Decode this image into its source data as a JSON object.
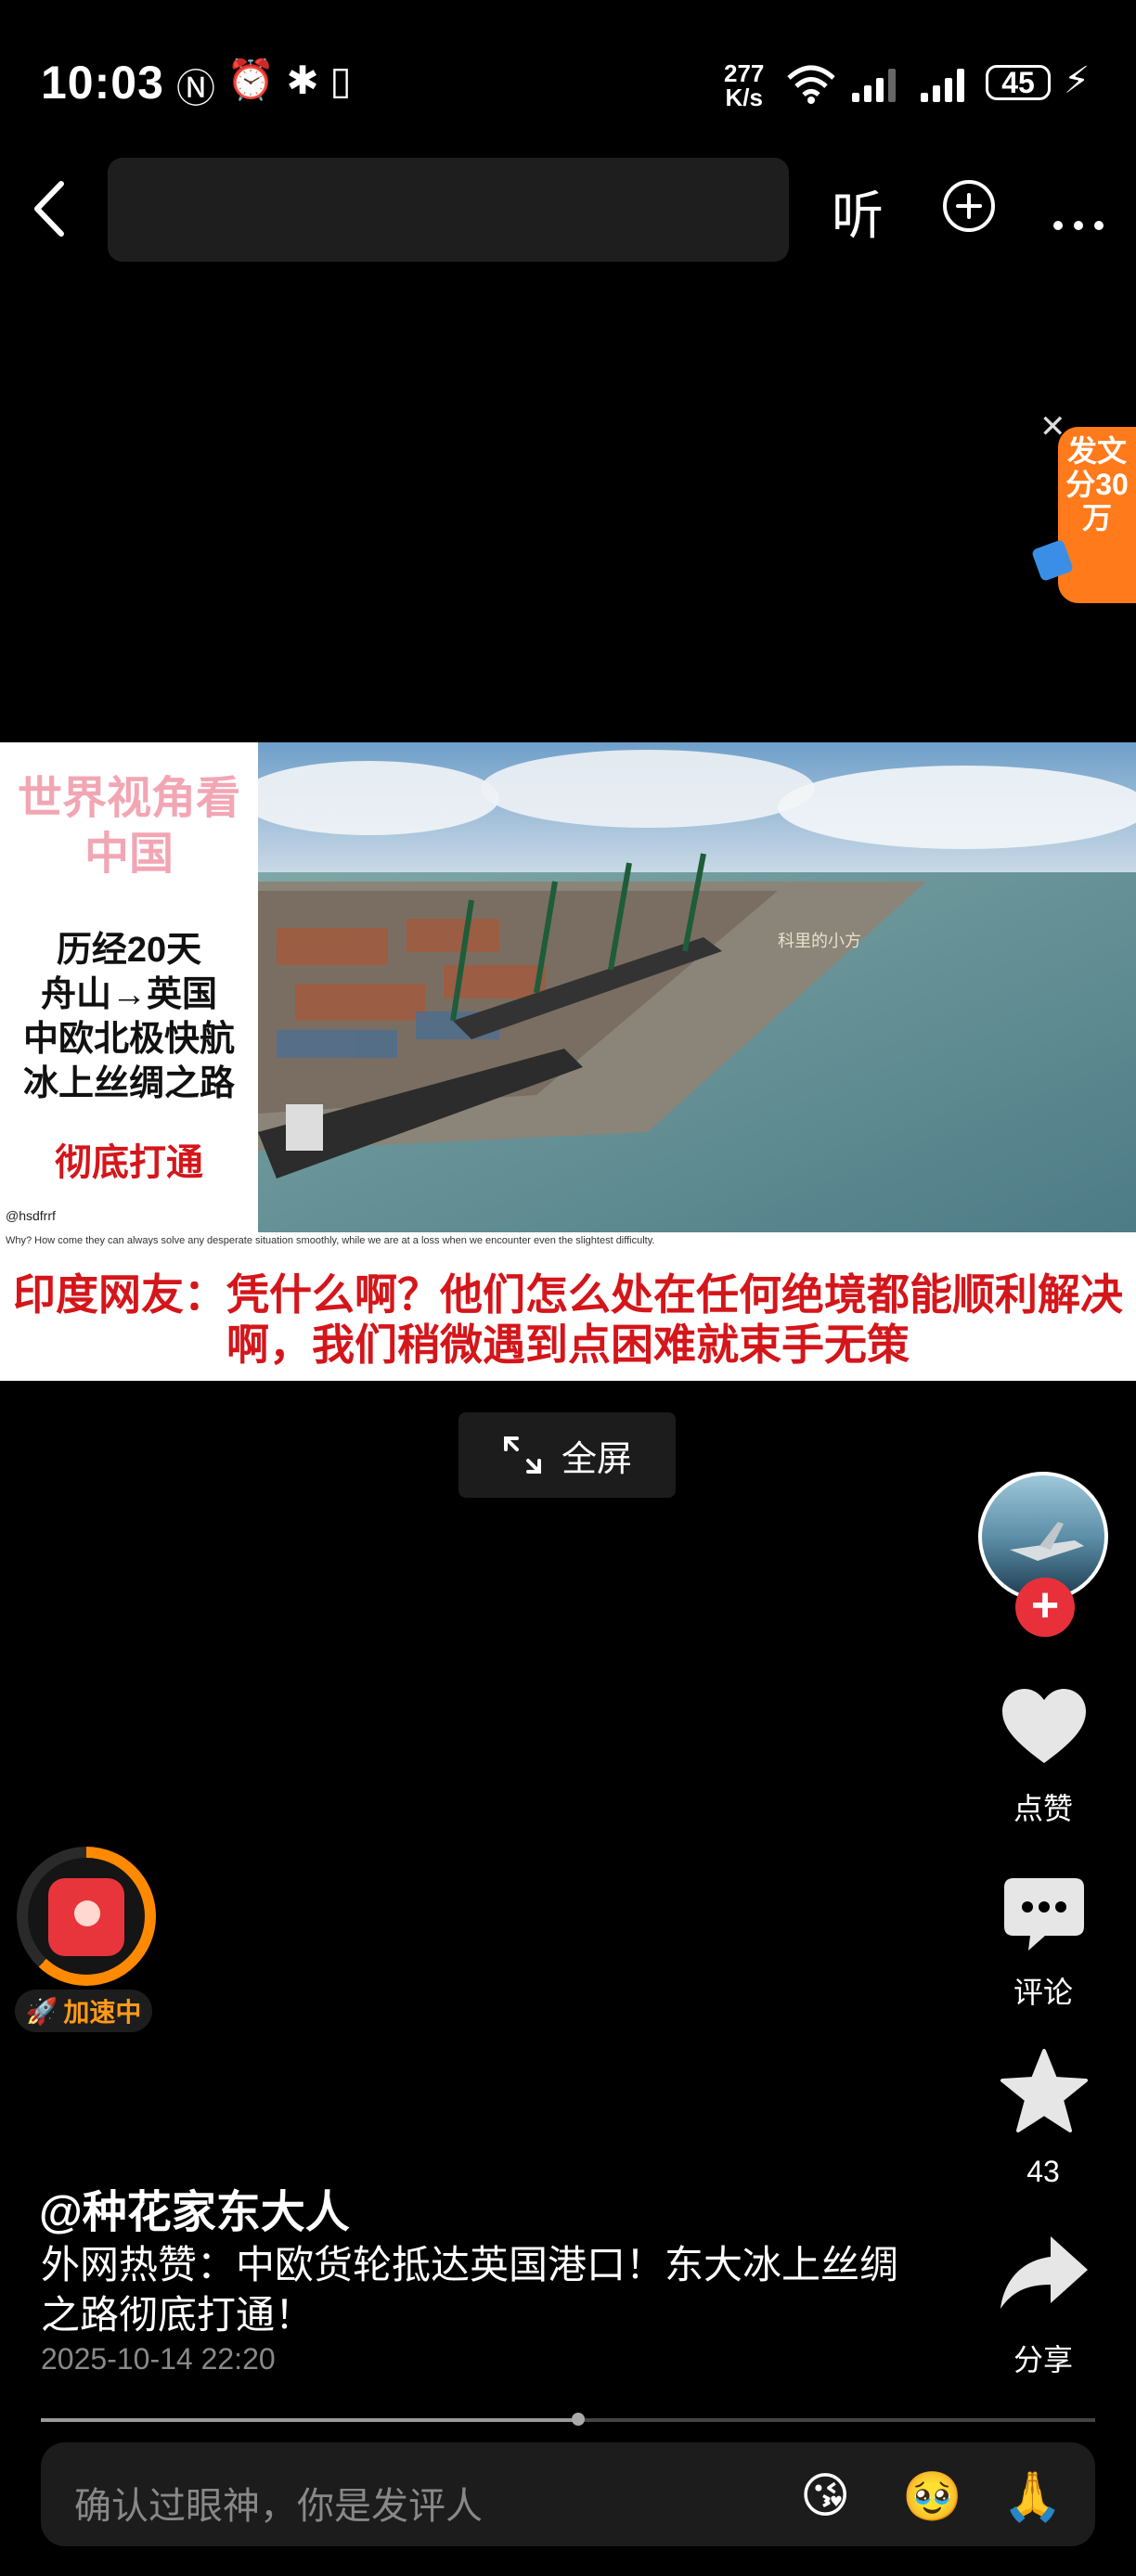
{
  "status_bar": {
    "time": "10:03",
    "net_speed_value": "277",
    "net_speed_unit": "K/s",
    "battery": "45"
  },
  "top_bar": {
    "search_placeholder": "",
    "listen_label": "听"
  },
  "promo": {
    "text": "发文分30万"
  },
  "video": {
    "left_title": "世界视角看中国",
    "left_body": [
      "历经20天",
      "舟山→英国",
      "中欧北极快航",
      "冰上丝绸之路"
    ],
    "left_highlight": "彻底打通",
    "handle": "@hsdfrrf",
    "watermark": "科里的小方",
    "caption_en": "Why? How come they can always solve any desperate situation smoothly, while we are at a loss when we encounter even the slightest difficulty.",
    "caption_cn": "印度网友：凭什么啊？他们怎么处在任何绝境都能顺利解决啊，我们稍微遇到点困难就束手无策"
  },
  "fullscreen_label": "全屏",
  "rail": {
    "like_label": "点赞",
    "comment_label": "评论",
    "favorite_count": "43",
    "share_label": "分享"
  },
  "red_packet": {
    "status": "加速中",
    "progress": 0.62
  },
  "post": {
    "author": "@种花家东大人",
    "caption": "外网热赞：中欧货轮抵达英国港口！东大冰上丝绸之路彻底打通！",
    "date": "2025-10-14 22:20"
  },
  "playback": {
    "progress": 0.51
  },
  "comment_input": {
    "placeholder": "确认过眼神，你是发评人",
    "emojis": [
      "😘",
      "🥹",
      "🙏"
    ]
  },
  "colors": {
    "accent_orange": "#ff7a1a",
    "follow_red": "#e8303a",
    "caption_red": "#d4161b"
  }
}
